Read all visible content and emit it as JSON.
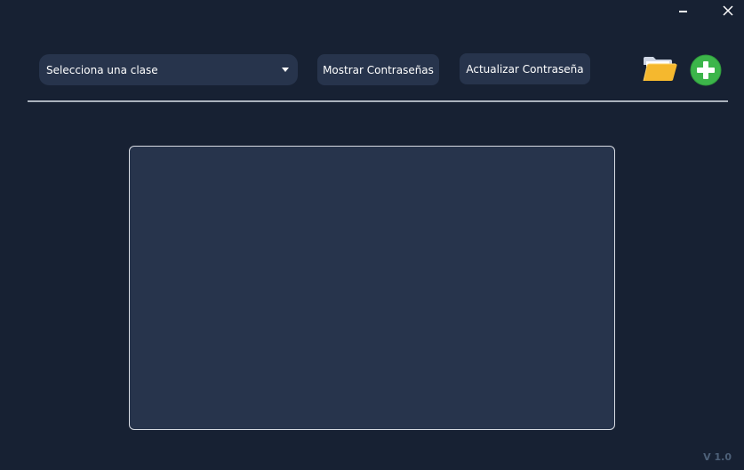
{
  "window_controls": {
    "minimize_icon": "minimize-icon",
    "close_icon": "close-icon"
  },
  "toolbar": {
    "class_select": {
      "selected": "Selecciona una clase",
      "icon": "chevron-down-icon"
    },
    "show_passwords_label": "Mostrar Contraseñas",
    "update_password_label": "Actualizar Contraseña",
    "folder_icon": "folder-open-icon",
    "add_icon": "plus-circle-icon"
  },
  "footer": {
    "version": "V 1.0"
  },
  "colors": {
    "background": "#172133",
    "surface": "#27344c",
    "divider": "#aab2bd",
    "panel_border": "#d8dce3",
    "folder": "#f5b82e",
    "add_green": "#3cb54a",
    "version_text": "#4d6078"
  }
}
